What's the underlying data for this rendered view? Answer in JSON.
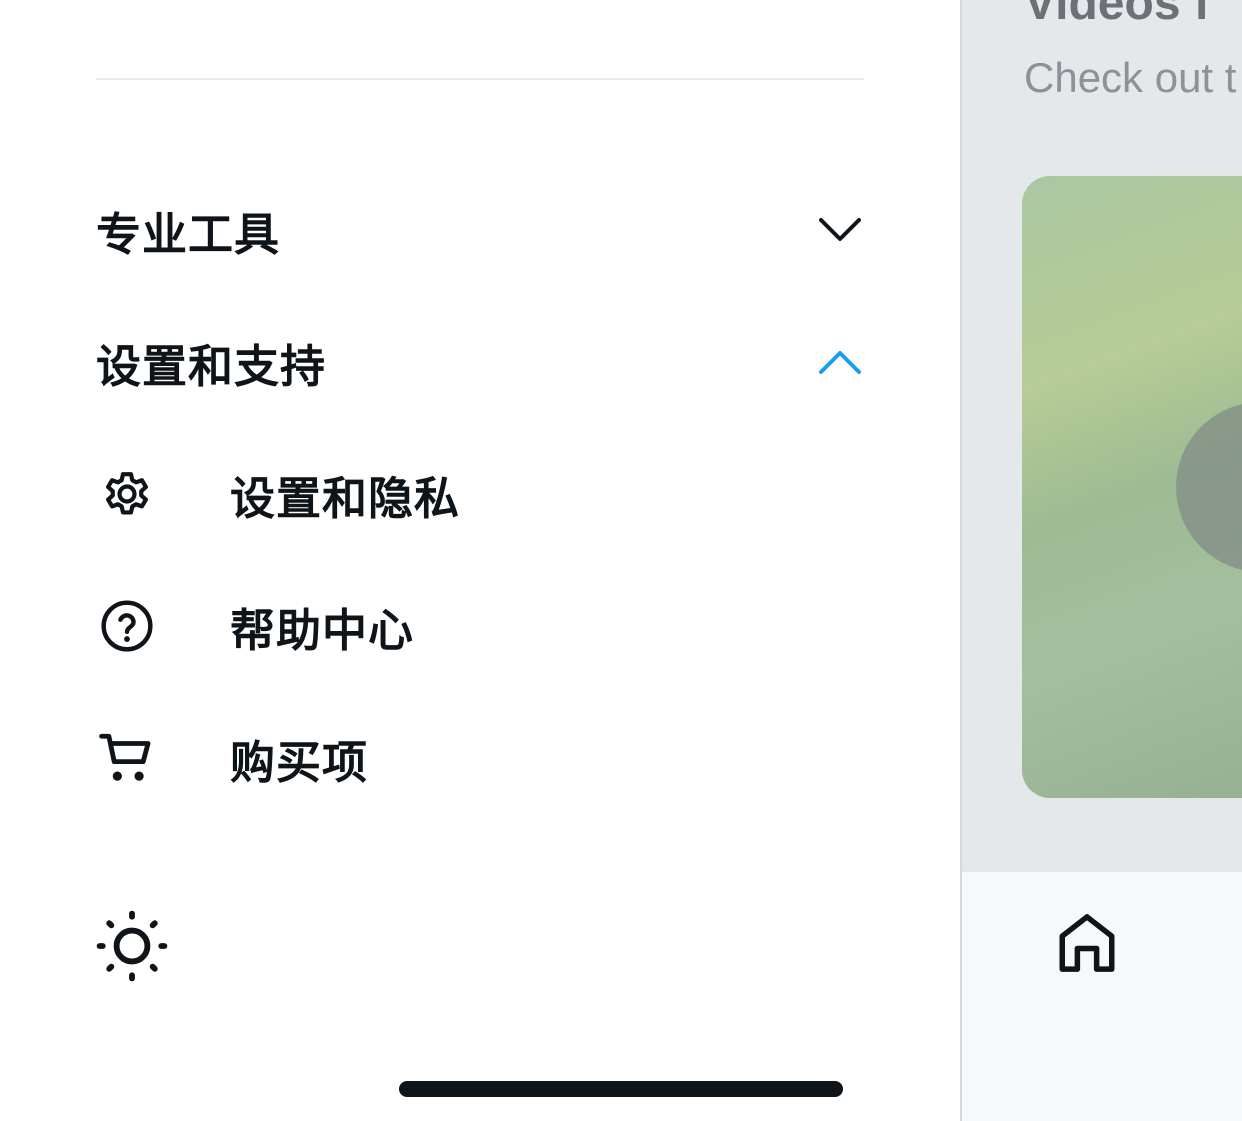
{
  "drawer": {
    "sections": [
      {
        "label": "专业工具",
        "expanded": false
      },
      {
        "label": "设置和支持",
        "expanded": true
      }
    ],
    "settings_items": [
      {
        "label": "设置和隐私",
        "icon": "gear-icon"
      },
      {
        "label": "帮助中心",
        "icon": "help-circle-icon"
      },
      {
        "label": "购买项",
        "icon": "shopping-cart-icon"
      }
    ],
    "display_icon": "sun-icon"
  },
  "main": {
    "title": "Videos f",
    "subtitle": "Check out t",
    "tab_icon": "home-icon"
  },
  "colors": {
    "accent": "#1d9bf0",
    "text": "#0f1419"
  }
}
